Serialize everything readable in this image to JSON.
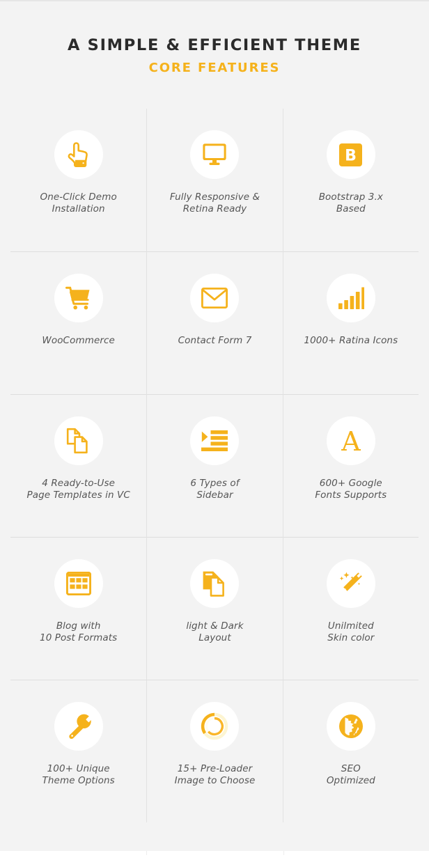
{
  "heading": {
    "main": "A SIMPLE & EFFICIENT THEME",
    "sub": "CORE FEATURES"
  },
  "colors": {
    "accent": "#f5b21c",
    "accent_alt": "#fab629",
    "heading": "#2b2b2b",
    "caption": "#555555",
    "section_bg": "#f3f3f3",
    "circle_bg": "#ffffff",
    "divider": "#e2e2e2"
  },
  "features": [
    {
      "icon": "pointing-hand-icon",
      "label": "One-Click Demo\nInstallation"
    },
    {
      "icon": "desktop-monitor-icon",
      "label": "Fully Responsive &\nRetina Ready"
    },
    {
      "icon": "bootstrap-b-icon",
      "label": "Bootstrap 3.x\nBased"
    },
    {
      "icon": "shopping-cart-icon",
      "label": "WooCommerce"
    },
    {
      "icon": "envelope-icon",
      "label": "Contact Form 7"
    },
    {
      "icon": "bar-chart-icon",
      "label": "1000+ Ratina Icons"
    },
    {
      "icon": "copy-pages-icon",
      "label": "4 Ready-to-Use\nPage Templates in VC"
    },
    {
      "icon": "indent-list-icon",
      "label": "6 Types of\nSidebar"
    },
    {
      "icon": "font-letter-a-icon",
      "label": "600+ Google\nFonts Supports"
    },
    {
      "icon": "grid-table-icon",
      "label": "Blog with\n10 Post Formats"
    },
    {
      "icon": "documents-stack-icon",
      "label": "light & Dark\nLayout"
    },
    {
      "icon": "magic-wand-icon",
      "label": "Unilmited\nSkin color"
    },
    {
      "icon": "wrench-icon",
      "label": "100+ Unique\nTheme Options"
    },
    {
      "icon": "spinner-loader-icon",
      "label": "15+ Pre-Loader\nImage to Choose"
    },
    {
      "icon": "globe-icon",
      "label": "SEO\nOptimized"
    }
  ]
}
